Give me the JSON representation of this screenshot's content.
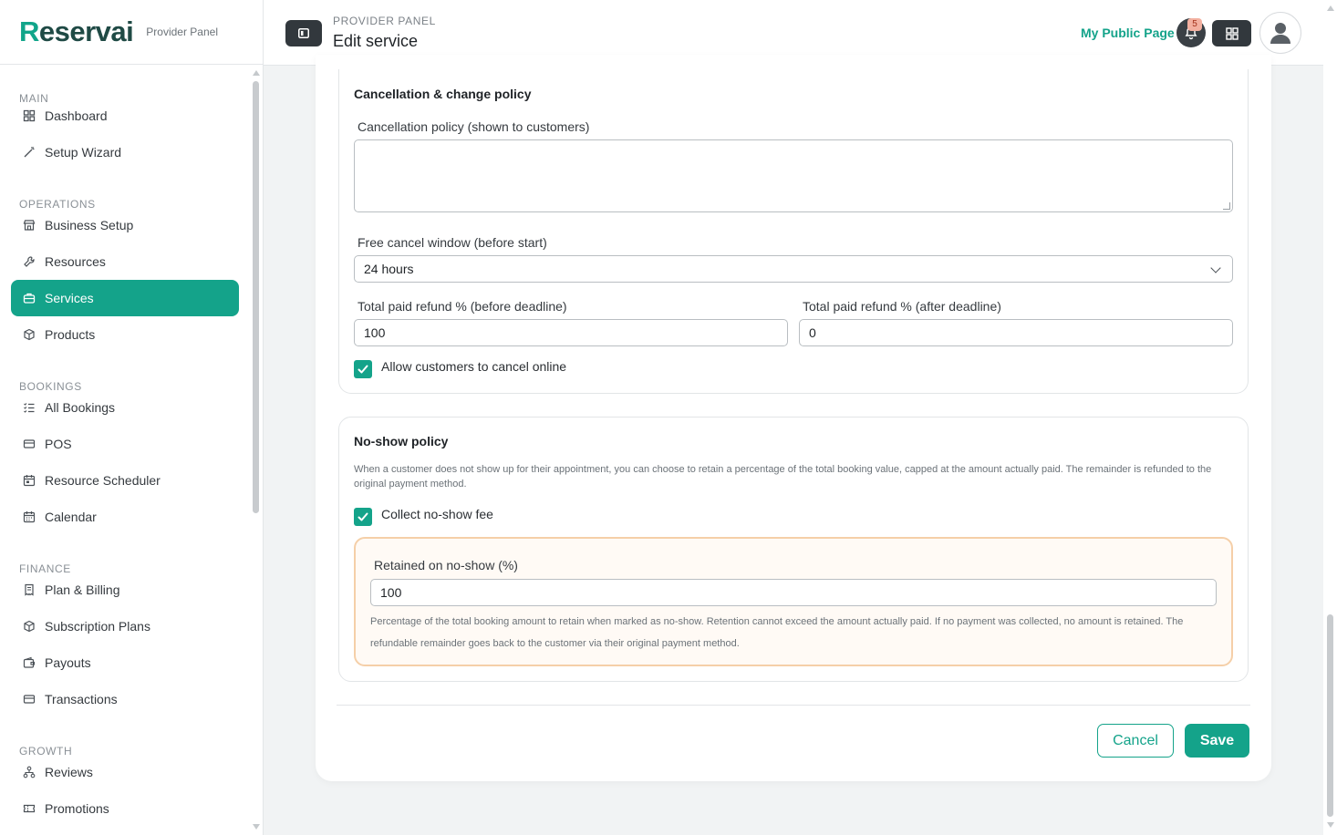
{
  "app": {
    "logo": "Reservai",
    "logo_first": "R",
    "logo_rest": "eservai",
    "subtitle": "Provider Panel",
    "accent_color": "#14a38a"
  },
  "header": {
    "breadcrumb": "PROVIDER PANEL",
    "title": "Edit service",
    "public_page_link": "My Public Page",
    "notification_count": "5",
    "icons": [
      "sidebar-toggle-icon",
      "bell-icon",
      "grid-icon",
      "user-icon"
    ]
  },
  "sidebar": {
    "sections": [
      {
        "title": "MAIN",
        "items": [
          {
            "label": "Dashboard",
            "icon": "grid-icon"
          },
          {
            "label": "Setup Wizard",
            "icon": "magic-wand-icon"
          }
        ]
      },
      {
        "title": "OPERATIONS",
        "items": [
          {
            "label": "Business Setup",
            "icon": "store-icon"
          },
          {
            "label": "Resources",
            "icon": "wrench-icon"
          },
          {
            "label": "Services",
            "icon": "briefcase-icon",
            "active": true
          },
          {
            "label": "Products",
            "icon": "box-icon"
          }
        ]
      },
      {
        "title": "BOOKINGS",
        "items": [
          {
            "label": "All Bookings",
            "icon": "list-check-icon"
          },
          {
            "label": "POS",
            "icon": "card-icon"
          },
          {
            "label": "Resource Scheduler",
            "icon": "calendar-icon"
          },
          {
            "label": "Calendar",
            "icon": "calendar-grid-icon"
          }
        ]
      },
      {
        "title": "FINANCE",
        "items": [
          {
            "label": "Plan & Billing",
            "icon": "receipt-icon"
          },
          {
            "label": "Subscription Plans",
            "icon": "box-icon"
          },
          {
            "label": "Payouts",
            "icon": "wallet-icon"
          },
          {
            "label": "Transactions",
            "icon": "card-icon"
          }
        ]
      },
      {
        "title": "GROWTH",
        "items": [
          {
            "label": "Reviews",
            "icon": "network-icon"
          },
          {
            "label": "Promotions",
            "icon": "ticket-icon"
          }
        ]
      }
    ]
  },
  "cancellation": {
    "title": "Cancellation & change policy",
    "policy_label": "Cancellation policy (shown to customers)",
    "policy_value": "",
    "window_label": "Free cancel window (before start)",
    "window_value": "24 hours",
    "refund_before_label": "Total paid refund % (before deadline)",
    "refund_before_value": "100",
    "refund_after_label": "Total paid refund % (after deadline)",
    "refund_after_value": "0",
    "allow_online_label": "Allow customers to cancel online",
    "allow_online_checked": true
  },
  "noshow": {
    "title": "No-show policy",
    "description": "When a customer does not show up for their appointment, you can choose to retain a percentage of the total booking value, capped at the amount actually paid. The remainder is refunded to the original payment method.",
    "collect_label": "Collect no-show fee",
    "collect_checked": true,
    "retained_label": "Retained on no-show (%)",
    "retained_value": "100",
    "retained_help": "Percentage of the total booking amount to retain when marked as no-show. Retention cannot exceed the amount actually paid. If no payment was collected, no amount is retained. The refundable remainder goes back to the customer via their original payment method."
  },
  "actions": {
    "cancel_label": "Cancel",
    "save_label": "Save"
  }
}
